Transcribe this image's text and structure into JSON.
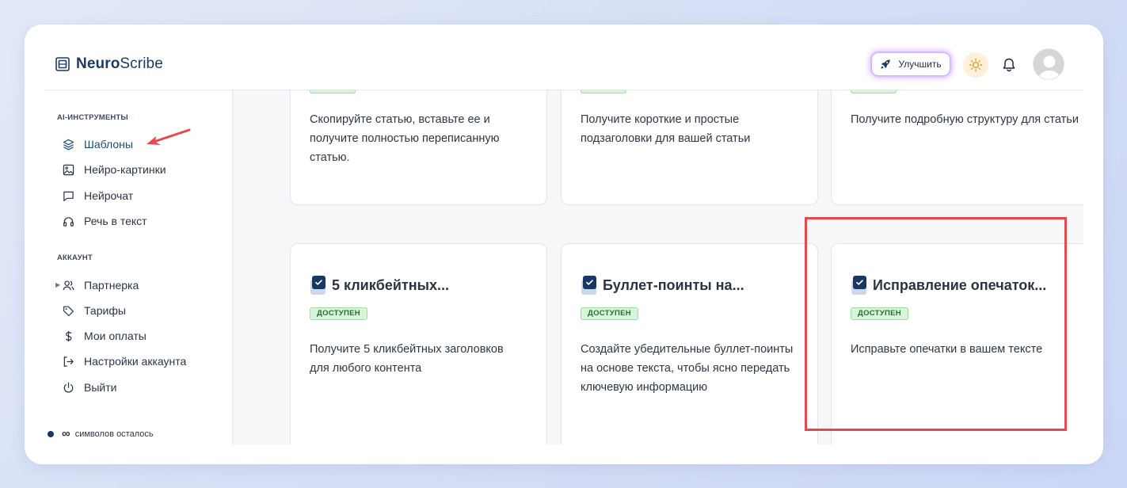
{
  "brand": {
    "name_bold": "Neuro",
    "name_regular": "Scribe"
  },
  "header": {
    "upgrade_label": "Улучшить"
  },
  "sidebar": {
    "ai_section": "AI-ИНСТРУМЕНТЫ",
    "ai_items": [
      {
        "label": "Шаблоны",
        "icon": "layers-icon",
        "active": true
      },
      {
        "label": "Нейро-картинки",
        "icon": "image-icon"
      },
      {
        "label": "Нейрочат",
        "icon": "chat-icon"
      },
      {
        "label": "Речь в текст",
        "icon": "headphones-icon"
      }
    ],
    "account_section": "АККАУНТ",
    "account_items": [
      {
        "label": "Партнерка",
        "icon": "users-icon"
      },
      {
        "label": "Тарифы",
        "icon": "tag-icon"
      },
      {
        "label": "Мои оплаты",
        "icon": "dollar-icon"
      },
      {
        "label": "Настройки аккаунта",
        "icon": "logout-arrow-icon"
      },
      {
        "label": "Выйти",
        "icon": "power-icon"
      }
    ],
    "symbols_value": "∞",
    "symbols_label": "символов осталось"
  },
  "cards_top": [
    {
      "description": "Скопируйте статью, вставьте ее и получите полностью переписанную статью."
    },
    {
      "description": "Получите короткие и простые подзаголовки для вашей статьи"
    },
    {
      "description": "Получите подробную структуру для статьи"
    }
  ],
  "cards": [
    {
      "title": "5 кликбейтных...",
      "badge": "ДОСТУПЕН",
      "description": "Получите 5 кликбейтных заголовков для любого контента"
    },
    {
      "title": "Буллет-поинты на...",
      "badge": "ДОСТУПЕН",
      "description": "Создайте убедительные буллет-поинты на основе текста, чтобы ясно передать ключевую информацию"
    },
    {
      "title": "Исправление опечаток...",
      "badge": "ДОСТУПЕН",
      "description": "Исправьте опечатки в вашем тексте"
    }
  ],
  "colors": {
    "brand_navy": "#1d3a63",
    "badge_green_bg": "#d7f5d8",
    "badge_green_text": "#2d6b33",
    "highlight_red": "#e5484d",
    "arrow_red": "#e5484d"
  }
}
